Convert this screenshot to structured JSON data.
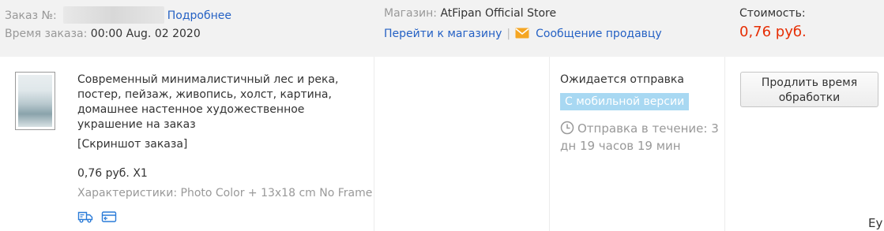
{
  "order_header": {
    "order_no_label": "Заказ №:",
    "details_link": "Подробнее",
    "order_time_label": "Время заказа:",
    "order_time_value": "00:00 Aug. 02 2020",
    "store_label": "Магазин:",
    "store_name": "AtFipan Official Store",
    "go_to_store_link": "Перейти к магазину",
    "separator": "|",
    "message_seller_link": "Сообщение продавцу",
    "cost_label": "Стоимость:",
    "cost_value": "0,76 руб."
  },
  "item": {
    "title": "Современный минималистичный лес и река, постер, пейзаж, живопись, холст, картина, домашнее настенное художественное украшение на заказ",
    "snapshot_link": "[Скриншот заказа]",
    "unit_price": "0,76 руб. X1",
    "properties": "Характеристики: Photo Color + 13x18 cm No Frame"
  },
  "status": {
    "label": "Ожидается отправка",
    "mobile_badge": "С мобильной версии",
    "ship_time": "Отправка в течение: 3 дн 19 часов 19 мин"
  },
  "actions": {
    "extend_button": "Продлить время обработки"
  },
  "footer": {
    "corner_text": "Ey"
  },
  "colors": {
    "link": "#2561c4",
    "price": "#e62e04",
    "badge": "#a8d8f2",
    "mail_icon": "#f5a623"
  },
  "icons": [
    "mail-icon",
    "clock-icon",
    "delivery-truck-icon",
    "card-icon"
  ]
}
